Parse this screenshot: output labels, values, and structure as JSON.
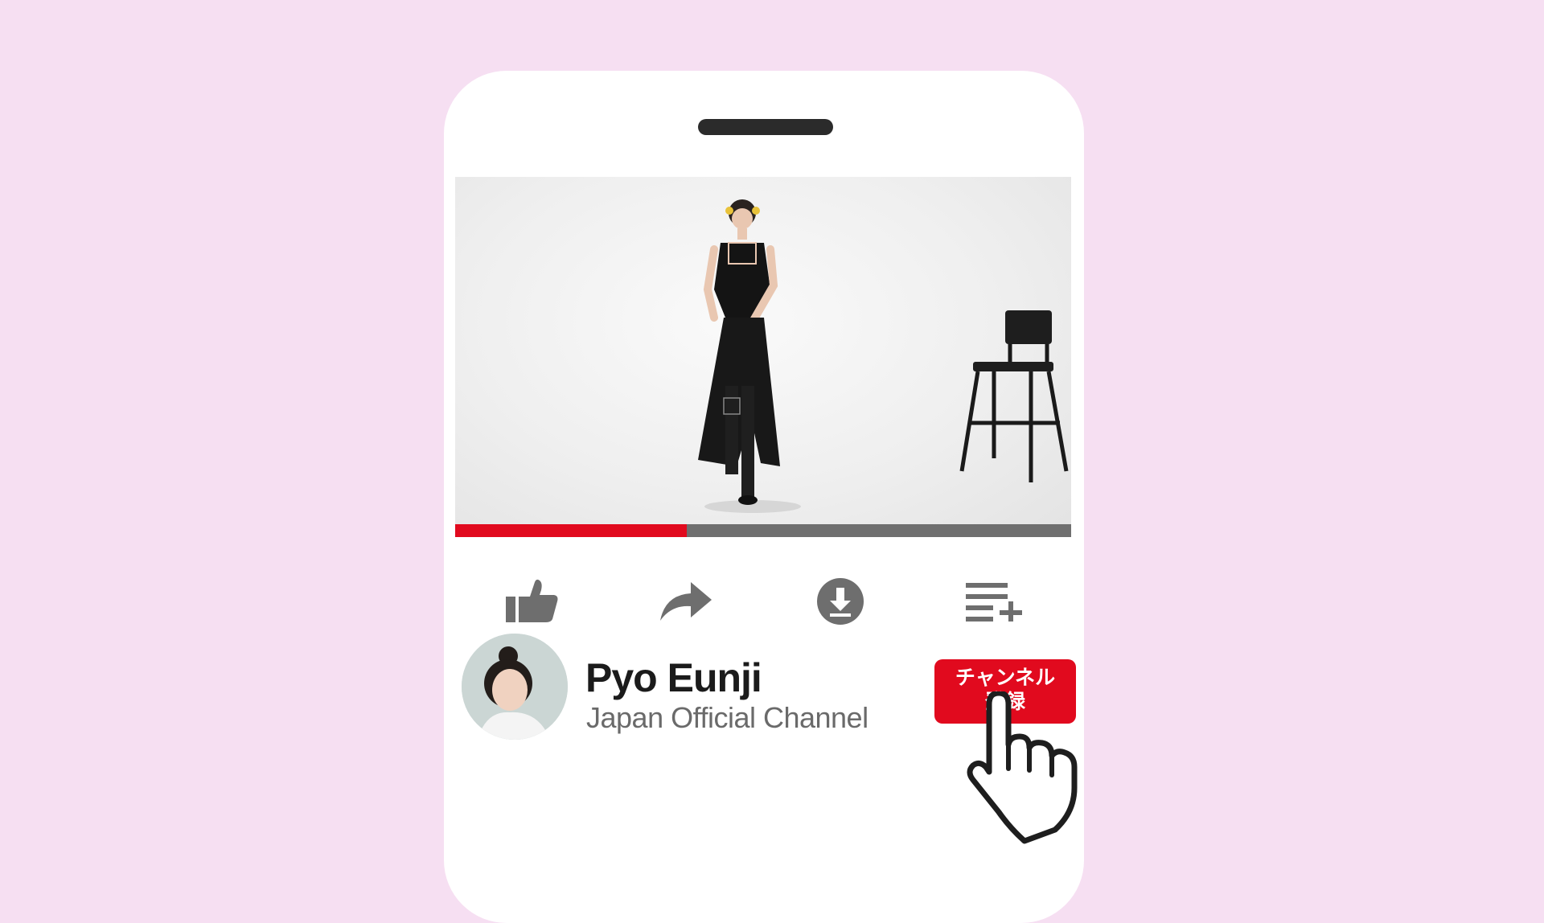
{
  "player": {
    "progress": 0.376,
    "colors": {
      "progress": "#e10a1e",
      "track": "#6f6f6f",
      "icons": "#6e6e6e"
    }
  },
  "actions": [
    {
      "name": "like",
      "icon": "thumbs-up-icon"
    },
    {
      "name": "share",
      "icon": "share-arrow-icon"
    },
    {
      "name": "download",
      "icon": "download-icon"
    },
    {
      "name": "save-to-playlist",
      "icon": "playlist-add-icon"
    }
  ],
  "channel": {
    "name": "Pyo Eunji",
    "subtitle": "Japan Official Channel",
    "subscribe_label_line1": "チャンネル",
    "subscribe_label_line2": "登録",
    "subscribe_color": "#e10a1e"
  },
  "background_color": "#f6dff2"
}
